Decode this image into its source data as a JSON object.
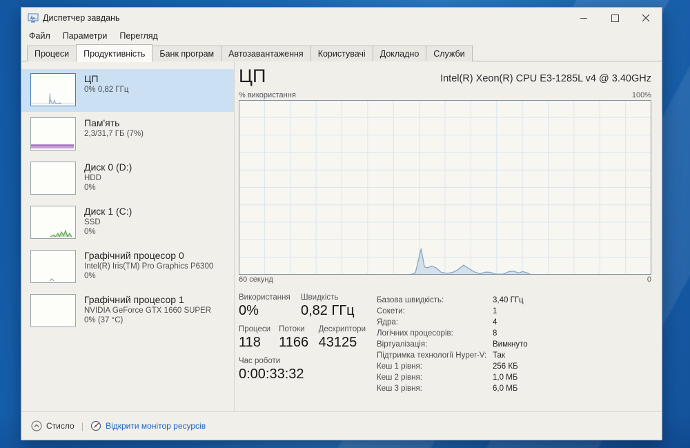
{
  "window": {
    "title": "Диспетчер завдань"
  },
  "menu": {
    "items": [
      {
        "id": "file",
        "label": "Файл"
      },
      {
        "id": "options",
        "label": "Параметри"
      },
      {
        "id": "view",
        "label": "Перегляд"
      }
    ]
  },
  "tabs": {
    "active_index": 1,
    "items": [
      {
        "id": "processes",
        "label": "Процеси"
      },
      {
        "id": "performance",
        "label": "Продуктивність"
      },
      {
        "id": "app-history",
        "label": "Банк програм"
      },
      {
        "id": "startup",
        "label": "Автозавантаження"
      },
      {
        "id": "users",
        "label": "Користувачі"
      },
      {
        "id": "details",
        "label": "Докладно"
      },
      {
        "id": "services",
        "label": "Служби"
      }
    ]
  },
  "sidebar": {
    "items": [
      {
        "id": "cpu",
        "title": "ЦП",
        "lines": [
          "0% 0,82 ГГц"
        ],
        "selected": true,
        "thumb": "cpu"
      },
      {
        "id": "memory",
        "title": "Пам'ять",
        "lines": [
          "2,3/31,7 ГБ (7%)"
        ],
        "selected": false,
        "thumb": "memory"
      },
      {
        "id": "disk0",
        "title": "Диск 0 (D:)",
        "lines": [
          "HDD",
          "0%"
        ],
        "selected": false,
        "thumb": "empty"
      },
      {
        "id": "disk1",
        "title": "Диск 1 (C:)",
        "lines": [
          "SSD",
          "0%"
        ],
        "selected": false,
        "thumb": "disk"
      },
      {
        "id": "gpu0",
        "title": "Графічний процесор 0",
        "lines": [
          "Intel(R) Iris(TM) Pro Graphics P6300",
          "0%"
        ],
        "selected": false,
        "thumb": "gpu"
      },
      {
        "id": "gpu1",
        "title": "Графічний процесор 1",
        "lines": [
          "NVIDIA GeForce GTX 1660 SUPER",
          "0% (37 °C)"
        ],
        "selected": false,
        "thumb": "empty"
      }
    ]
  },
  "main": {
    "title": "ЦП",
    "subtitle": "Intel(R) Xeon(R) CPU E3-1285L v4 @ 3.40GHz",
    "graph_labels": {
      "top_left": "% використання",
      "top_right": "100%",
      "bottom_left": "60 секунд",
      "bottom_right": "0"
    },
    "stats_left_rows": [
      [
        {
          "label": "Використання",
          "value": "0%"
        },
        {
          "label": "Швидкість",
          "value": "0,82 ГГц"
        }
      ],
      [
        {
          "label": "Процеси",
          "value": "118"
        },
        {
          "label": "Потоки",
          "value": "1166"
        },
        {
          "label": "Дескриптори",
          "value": "43125"
        }
      ],
      [
        {
          "label": "Час роботи",
          "value": "0:00:33:32"
        }
      ]
    ],
    "stats_right": [
      {
        "label": "Базова швидкість:",
        "value": "3,40 ГГц"
      },
      {
        "label": "Сокети:",
        "value": "1"
      },
      {
        "label": "Ядра:",
        "value": "4"
      },
      {
        "label": "Логічних процесорів:",
        "value": "8"
      },
      {
        "label": "Віртуалізація:",
        "value": "Вимкнуто"
      },
      {
        "label": "Підтримка технології Hyper-V:",
        "value": "Так"
      },
      {
        "label": "Кеш 1 рівня:",
        "value": "256 КБ"
      },
      {
        "label": "Кеш 2 рівня:",
        "value": "1,0 МБ"
      },
      {
        "label": "Кеш 3 рівня:",
        "value": "6,0 МБ"
      }
    ]
  },
  "footer": {
    "collapse_label": "Стисло",
    "resource_monitor_label": "Відкрити монітор ресурсів"
  },
  "colors": {
    "accent_link": "#1a62c5",
    "selection_bg": "#cbe0f3",
    "graph_border": "#7f93a6",
    "graph_grid": "#dbe5ee",
    "cpu_line": "#87a6c6",
    "cpu_fill": "rgba(170,198,226,0.45)",
    "mem_fill": "#c79bd8",
    "mem_line": "#8b4ba8",
    "disk_green": "#4e9a3c",
    "gpu_blip": "#8a97a4",
    "desktop_blue": "#1d77cd"
  },
  "chart_data": {
    "type": "area",
    "title": "ЦП — % використання",
    "ylabel": "% використання",
    "y_max_label": "100%",
    "xlabel_left": "60 секунд",
    "xlabel_right": "0",
    "ylim": [
      0,
      100
    ],
    "x_window_seconds": 60,
    "grid": {
      "cols": 16,
      "rows": 10,
      "visible": true
    },
    "legend": "none",
    "series": [
      {
        "name": "CPU % використання",
        "points_x_fraction_percent": [
          [
            0.0,
            0
          ],
          [
            0.415,
            0
          ],
          [
            0.428,
            1
          ],
          [
            0.442,
            15
          ],
          [
            0.45,
            4.5
          ],
          [
            0.458,
            4
          ],
          [
            0.468,
            5
          ],
          [
            0.478,
            4
          ],
          [
            0.49,
            1.5
          ],
          [
            0.505,
            0.8
          ],
          [
            0.52,
            1.5
          ],
          [
            0.532,
            3
          ],
          [
            0.545,
            5.5
          ],
          [
            0.558,
            3.5
          ],
          [
            0.572,
            1.5
          ],
          [
            0.585,
            0.6
          ],
          [
            0.598,
            1.5
          ],
          [
            0.61,
            1.4
          ],
          [
            0.622,
            0.4
          ],
          [
            0.64,
            0.3
          ],
          [
            0.655,
            1.8
          ],
          [
            0.667,
            2.0
          ],
          [
            0.678,
            1.0
          ],
          [
            0.688,
            1.8
          ],
          [
            0.698,
            1.2
          ],
          [
            0.708,
            0
          ],
          [
            1.0,
            0
          ]
        ]
      }
    ]
  }
}
